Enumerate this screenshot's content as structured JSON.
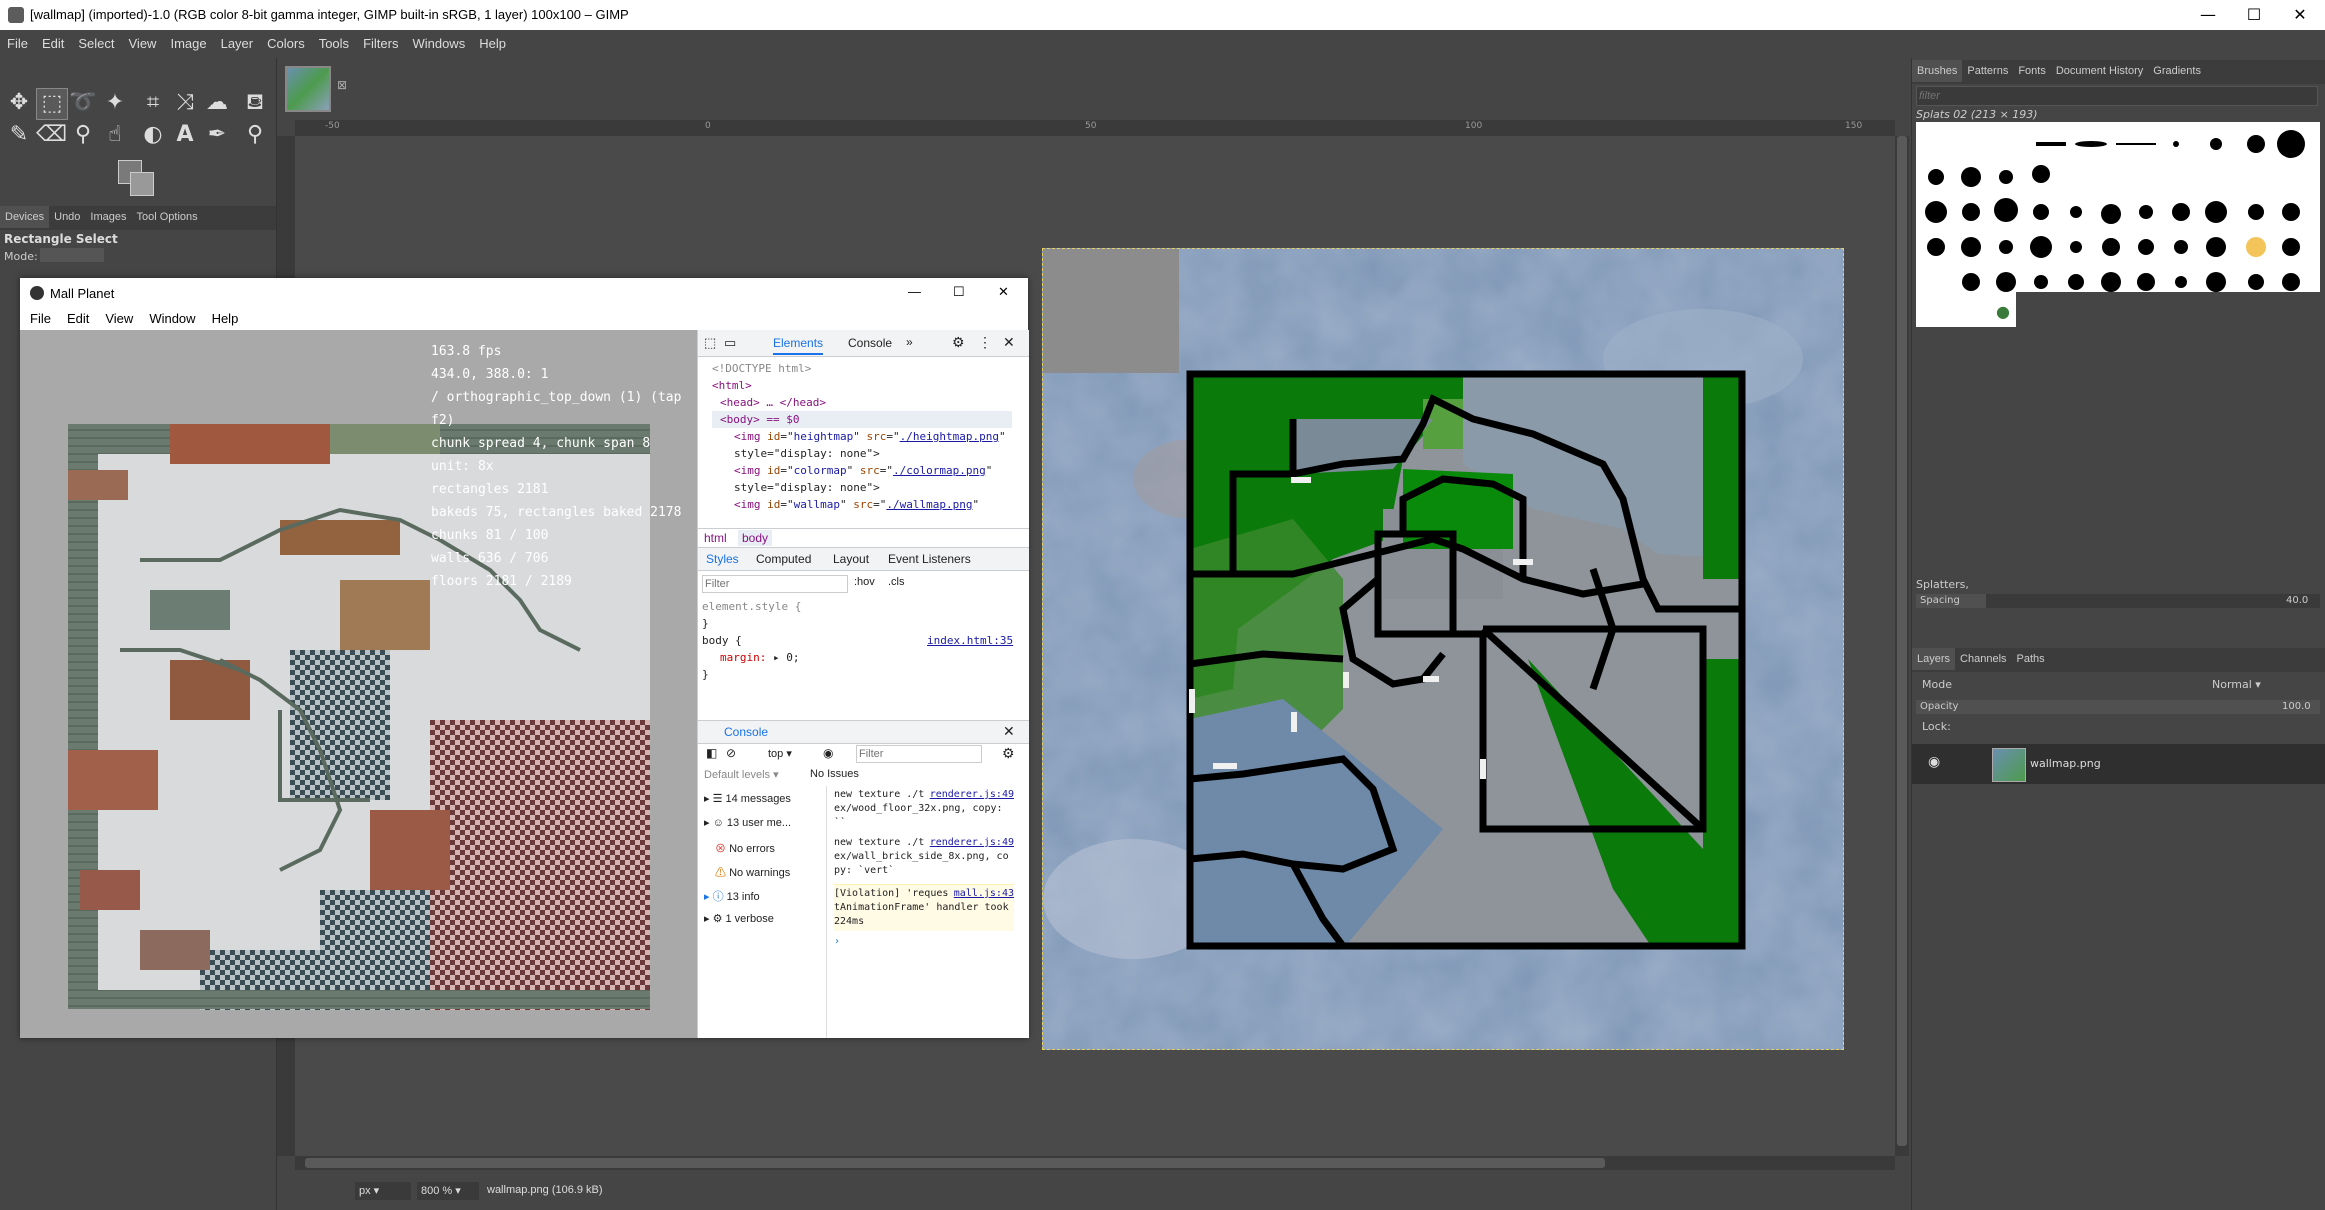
{
  "window": {
    "title": "[wallmap] (imported)-1.0 (RGB color 8-bit gamma integer, GIMP built-in sRGB, 1 layer) 100x100 – GIMP",
    "minimize": "—",
    "maximize": "☐",
    "close": "✕"
  },
  "menubar": [
    "File",
    "Edit",
    "Select",
    "View",
    "Image",
    "Layer",
    "Colors",
    "Tools",
    "Filters",
    "Windows",
    "Help"
  ],
  "toolbox": {
    "tools": [
      "move-icon",
      "rect-select-icon",
      "lasso-icon",
      "fuzzy-select-icon",
      "crop-icon",
      "transform-icon",
      "warp-icon",
      "bucket-fill-icon",
      "paintbrush-icon",
      "eraser-icon",
      "clone-icon",
      "smudge-icon",
      "dodge-icon",
      "text-icon",
      "color-picker-icon",
      "zoom-icon"
    ],
    "dock_tabs": [
      "Devices",
      "Undo",
      "Images",
      "Tool Options"
    ],
    "tool_options_title": "Rectangle Select",
    "mode_label": "Mode:"
  },
  "ruler": {
    "ticks": [
      "-50",
      "0",
      "50",
      "100",
      "150"
    ]
  },
  "statusbar": {
    "unit": "px",
    "zoom": "800 %",
    "file": "wallmap.png (106.9 kB)"
  },
  "rightdock": {
    "tabs": [
      "Brushes",
      "Patterns",
      "Fonts",
      "Document History",
      "Gradients"
    ],
    "filter_placeholder": "filter",
    "brush_name": "Splats 02 (213 × 193)",
    "brush_selected": "Splatters,",
    "spacing_label": "Spacing",
    "spacing_value": "40.0",
    "layer_tabs": [
      "Layers",
      "Channels",
      "Paths"
    ],
    "mode_label": "Mode",
    "mode_value": "Normal",
    "opacity_label": "Opacity",
    "opacity_value": "100.0",
    "lock_label": "Lock:",
    "layer_name": "wallmap.png"
  },
  "mall": {
    "title": "Mall Planet",
    "menu": [
      "File",
      "Edit",
      "View",
      "Window",
      "Help"
    ],
    "hud": [
      "163.8 fps",
      "434.0, 388.0: 1",
      "/ orthographic_top_down (1) (tap f2)",
      "chunk spread 4, chunk span 8",
      "unit: 8x",
      "rectangles 2181",
      "bakeds 75, rectangles baked 2178",
      "chunks 81 / 100",
      "walls 636 / 706",
      "floors 2181 / 2189"
    ]
  },
  "devtools": {
    "tabs": [
      "Elements",
      "Console"
    ],
    "html": [
      "<!DOCTYPE html>",
      "<html>",
      "<head> … </head>",
      "<body> == $0"
    ],
    "imgs": [
      {
        "id": "heightmap",
        "src": "./heightmap.png"
      },
      {
        "id": "colormap",
        "src": "./colormap.png"
      },
      {
        "id": "wallmap",
        "src": "./wallmap.png"
      }
    ],
    "style_none": "style=\"display: none\">",
    "breadcrumb": [
      "html",
      "body"
    ],
    "style_tabs": [
      "Styles",
      "Computed",
      "Layout",
      "Event Listeners"
    ],
    "filter_placeholder": "Filter",
    "hov": ":hov",
    "cls": ".cls",
    "element_style": "element.style {",
    "close_brace": "}",
    "body_rule": "body {",
    "body_src": "index.html:35",
    "margin_prop": "margin:",
    "margin_val": "0;",
    "console_title": "Console",
    "console_top": "top",
    "console_filter": "Filter",
    "levels": "Default levels",
    "issues": "No Issues",
    "sidebar": [
      {
        "icon": "list-icon",
        "label": "14 messages"
      },
      {
        "icon": "user-icon",
        "label": "13 user me..."
      },
      {
        "icon": "error-icon",
        "label": "No errors"
      },
      {
        "icon": "warning-icon",
        "label": "No warnings"
      },
      {
        "icon": "info-icon",
        "label": "13 info"
      },
      {
        "icon": "verbose-icon",
        "label": "1 verbose"
      }
    ],
    "logs": [
      {
        "text": "new texture ./tex/wood_floor_32x.png, copy: ``",
        "src": "renderer.js:49"
      },
      {
        "text": "new texture ./tex/wall_brick_side_8x.png, copy: `vert`",
        "src": "renderer.js:49"
      },
      {
        "text": "[Violation] 'requestAnimationFrame' handler took 224ms",
        "src": "mall.js:43"
      }
    ],
    "prompt": "›"
  }
}
